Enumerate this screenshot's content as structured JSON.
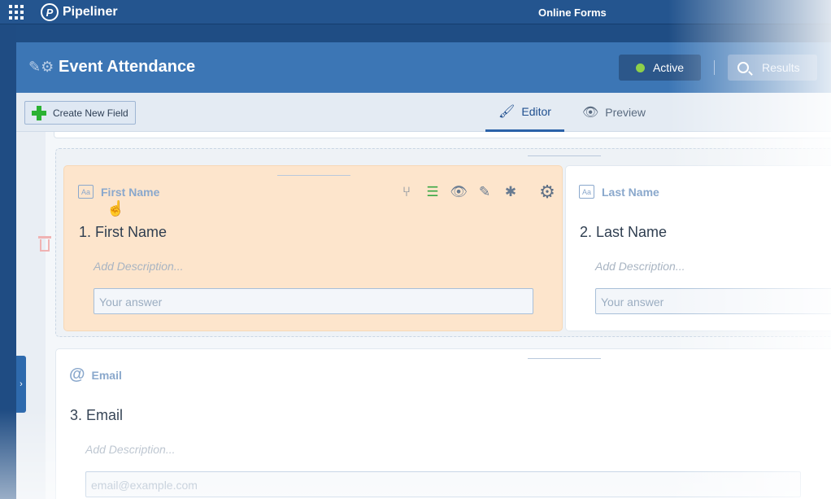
{
  "topbar": {
    "app_name": "Pipeliner",
    "module": "Online Forms"
  },
  "header": {
    "title": "Event Attendance",
    "status_label": "Active",
    "results_label": "Results"
  },
  "toolbar": {
    "create_label": "Create New Field",
    "tabs": [
      {
        "label": "Editor",
        "active": true
      },
      {
        "label": "Preview",
        "active": false
      }
    ]
  },
  "fields": [
    {
      "type_label": "First Name",
      "question": "1. First Name",
      "description_placeholder": "Add Description...",
      "input_placeholder": "Your answer",
      "selected": true
    },
    {
      "type_label": "Last Name",
      "question": "2. Last Name",
      "description_placeholder": "Add Description...",
      "input_placeholder": "Your answer",
      "selected": false
    },
    {
      "type_label": "Email",
      "question": "3. Email",
      "description_placeholder": "Add Description...",
      "input_placeholder": "email@example.com",
      "selected": false
    }
  ],
  "colors": {
    "header_bg": "#3c76b5",
    "active_dot": "#8ed04a",
    "selected_card": "#fde5cc",
    "create_plus": "#2bb233"
  }
}
